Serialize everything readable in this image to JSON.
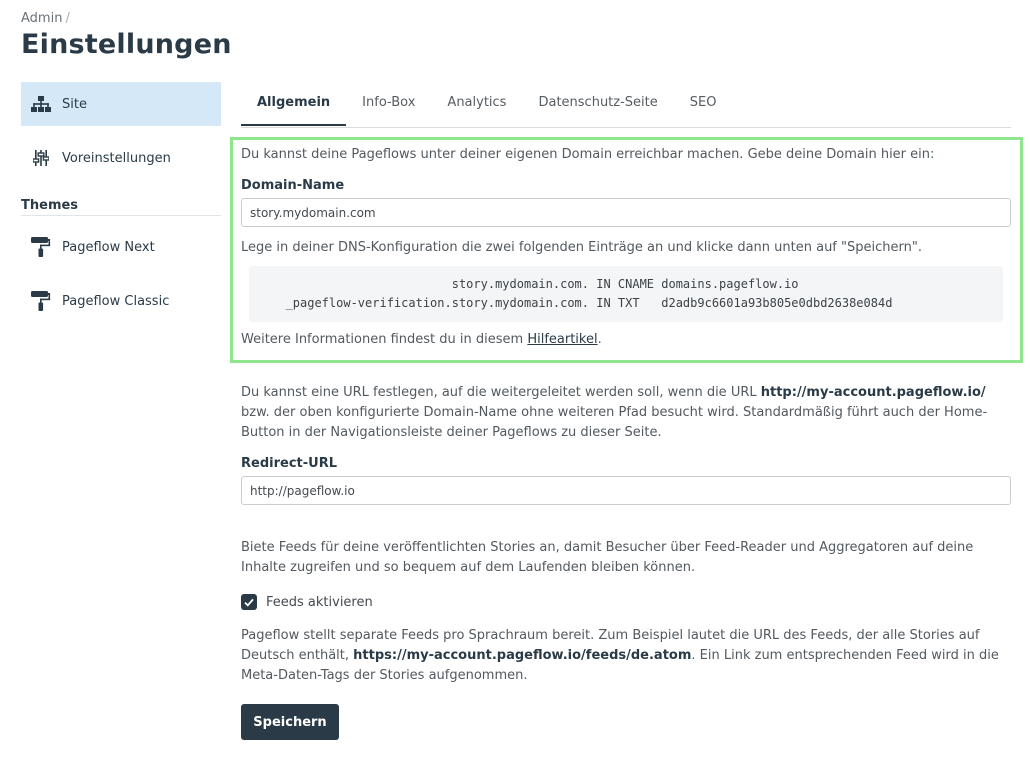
{
  "breadcrumb": {
    "root": "Admin",
    "separator": "/"
  },
  "page": {
    "title": "Einstellungen"
  },
  "sidebar": {
    "items": [
      {
        "label": "Site",
        "icon": "sitemap-icon",
        "active": true
      },
      {
        "label": "Voreinstellungen",
        "icon": "sliders-icon",
        "active": false
      }
    ],
    "themes_heading": "Themes",
    "themes": [
      {
        "label": "Pageflow Next",
        "icon": "paint-roller-icon"
      },
      {
        "label": "Pageflow Classic",
        "icon": "paint-roller-icon"
      }
    ]
  },
  "tabs": [
    {
      "label": "Allgemein",
      "active": true
    },
    {
      "label": "Info-Box",
      "active": false
    },
    {
      "label": "Analytics",
      "active": false
    },
    {
      "label": "Datenschutz-Seite",
      "active": false
    },
    {
      "label": "SEO",
      "active": false
    }
  ],
  "domain": {
    "intro": "Du kannst deine Pageflows unter deiner eigenen Domain erreichbar machen. Gebe deine Domain hier ein:",
    "label": "Domain-Name",
    "value": "story.mydomain.com",
    "dns_hint": "Lege in deiner DNS-Konfiguration die zwei folgenden Einträge an und klicke dann unten auf \"Speichern\".",
    "dns_records": [
      {
        "name": "story.mydomain.com.",
        "record": " IN CNAME domains.pageflow.io"
      },
      {
        "name": "_pageflow-verification.story.mydomain.com.",
        "record": " IN TXT   d2adb9c6601a93b805e0dbd2638e084d"
      }
    ],
    "info_prefix": "Weitere Informationen findest du in diesem ",
    "info_link": "Hilfeartikel",
    "info_suffix": "."
  },
  "redirect": {
    "text_1": "Du kannst eine URL festlegen, auf die weitergeleitet werden soll, wenn die URL ",
    "text_url": "http://my-account.pageflow.io/",
    "text_2": " bzw. der oben konfigurierte Domain-Name ohne weiteren Pfad besucht wird. Standardmäßig führt auch der Home-Button in der Navigationsleiste deiner Pageflows zu dieser Seite.",
    "label": "Redirect-URL",
    "value": "http://pageflow.io"
  },
  "feeds": {
    "intro": "Biete Feeds für deine veröffentlichten Stories an, damit Besucher über Feed-Reader und Aggregatoren auf deine Inhalte zugreifen und so bequem auf dem Laufenden bleiben können.",
    "checkbox_label": "Feeds aktivieren",
    "checked": true,
    "note_1": "Pageflow stellt separate Feeds pro Sprachraum bereit. Zum Beispiel lautet die URL des Feeds, der alle Stories auf Deutsch enthält, ",
    "note_url": "https://my-account.pageflow.io/feeds/de.atom",
    "note_2": ". Ein Link zum entsprechenden Feed wird in die Meta-Daten-Tags der Stories aufgenommen."
  },
  "actions": {
    "save_label": "Speichern"
  },
  "colors": {
    "primary": "#2a3b47",
    "active_bg": "#d4e8f7",
    "highlight": "#8fe68c"
  }
}
